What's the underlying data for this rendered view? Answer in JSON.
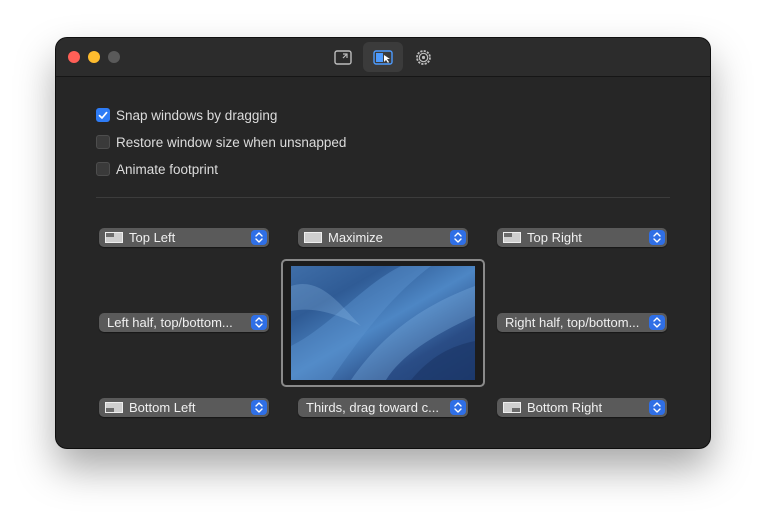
{
  "window": {
    "toolbar_tabs": [
      {
        "icon": "keyboard-shortcuts-icon",
        "active": false
      },
      {
        "icon": "snap-areas-icon",
        "active": true
      },
      {
        "icon": "gear-icon",
        "active": false
      }
    ]
  },
  "options": [
    {
      "label": "Snap windows by dragging",
      "checked": true
    },
    {
      "label": "Restore window size when unsnapped",
      "checked": false
    },
    {
      "label": "Animate footprint",
      "checked": false
    }
  ],
  "snap_areas": {
    "top_left": {
      "label": "Top Left",
      "icon": "top-left-quadrant-icon"
    },
    "top_center": {
      "label": "Maximize",
      "icon": "maximize-icon"
    },
    "top_right": {
      "label": "Top Right",
      "icon": "top-right-quadrant-icon"
    },
    "middle_left": {
      "label": "Left half, top/bottom..."
    },
    "middle_right": {
      "label": "Right half, top/bottom..."
    },
    "bottom_left": {
      "label": "Bottom Left",
      "icon": "bottom-left-quadrant-icon"
    },
    "bottom_center": {
      "label": "Thirds, drag toward c..."
    },
    "bottom_right": {
      "label": "Bottom Right",
      "icon": "bottom-right-quadrant-icon"
    }
  },
  "colors": {
    "accent": "#2e7cf6",
    "window_bg": "#262626",
    "popup_bg": "#5a5a5a",
    "traffic_close": "#ff5f57",
    "traffic_minimize": "#febc2e",
    "traffic_zoom_inactive": "#5a5a5a"
  }
}
